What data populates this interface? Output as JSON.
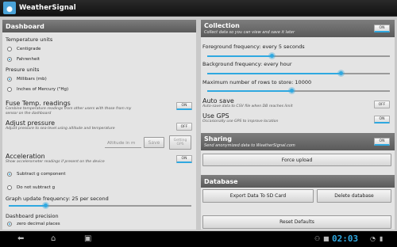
{
  "app": {
    "title": "WeatherSignal",
    "icon": "weather-signal-app-icon"
  },
  "dashboard": {
    "header": "Dashboard",
    "temperature_units": {
      "label": "Temperature units",
      "options": [
        "Centigrade",
        "Fahrenheit"
      ],
      "selected": "Fahrenheit"
    },
    "pressure_units": {
      "label": "Presure units",
      "options": [
        "Millibars (mb)",
        "Inches of Mercury (\"Hg)"
      ],
      "selected": "Millibars (mb)"
    },
    "fuse_temp": {
      "label": "Fuse Temp. readings",
      "desc": "Combine temperature readings from other users with those from my sensor on the dashboard",
      "toggle": "ON"
    },
    "adjust_pressure": {
      "label": "Adjust pressure",
      "desc": "Adjust pressure to sea-level using altitude and temperature",
      "toggle": "OFF",
      "altitude_placeholder": "Altitude in m",
      "save_label": "Save",
      "getting_gps_label": "Getting GPS"
    },
    "acceleration": {
      "label": "Acceleration",
      "desc": "Show accelerometer readings if present on the device",
      "toggle": "ON",
      "options": [
        "Subtract g component",
        "Do not subtract g"
      ],
      "selected": "Subtract g component"
    },
    "graph_update": {
      "label": "Graph update frequency: 25 per second",
      "value_fraction": 0.2
    },
    "precision": {
      "label": "Dashboard precision",
      "selected": "zero decimal places"
    }
  },
  "collection": {
    "header": "Collection",
    "subheader": "Collect data so you can view and save it later",
    "toggle": "ON",
    "foreground": {
      "label": "Foreground frequency: every 5 seconds",
      "value_fraction": 0.35
    },
    "background": {
      "label": "Background frequency: every hour",
      "value_fraction": 0.73
    },
    "max_rows": {
      "label": "Maximum number of rows to store: 10000",
      "value_fraction": 0.46
    },
    "auto_save": {
      "label": "Auto save",
      "desc": "Auto-save data to CSV file when DB reaches limit",
      "toggle": "OFF"
    },
    "use_gps": {
      "label": "Use GPS",
      "desc": "Occasionally use GPS to improve location",
      "toggle": "ON"
    }
  },
  "sharing": {
    "header": "Sharing",
    "subheader": "Send anonymized data to WeatherSignal.com",
    "toggle": "ON",
    "force_upload_label": "Force upload"
  },
  "database": {
    "header": "Database",
    "export_label": "Export Data To SD Card",
    "delete_label": "Delete database",
    "reset_label": "Reset Defaults"
  },
  "system_bar": {
    "clock": "02:03"
  },
  "colors": {
    "accent": "#2fa8e0",
    "panel": "#e4e4e4",
    "header": "#6b6b6b"
  }
}
